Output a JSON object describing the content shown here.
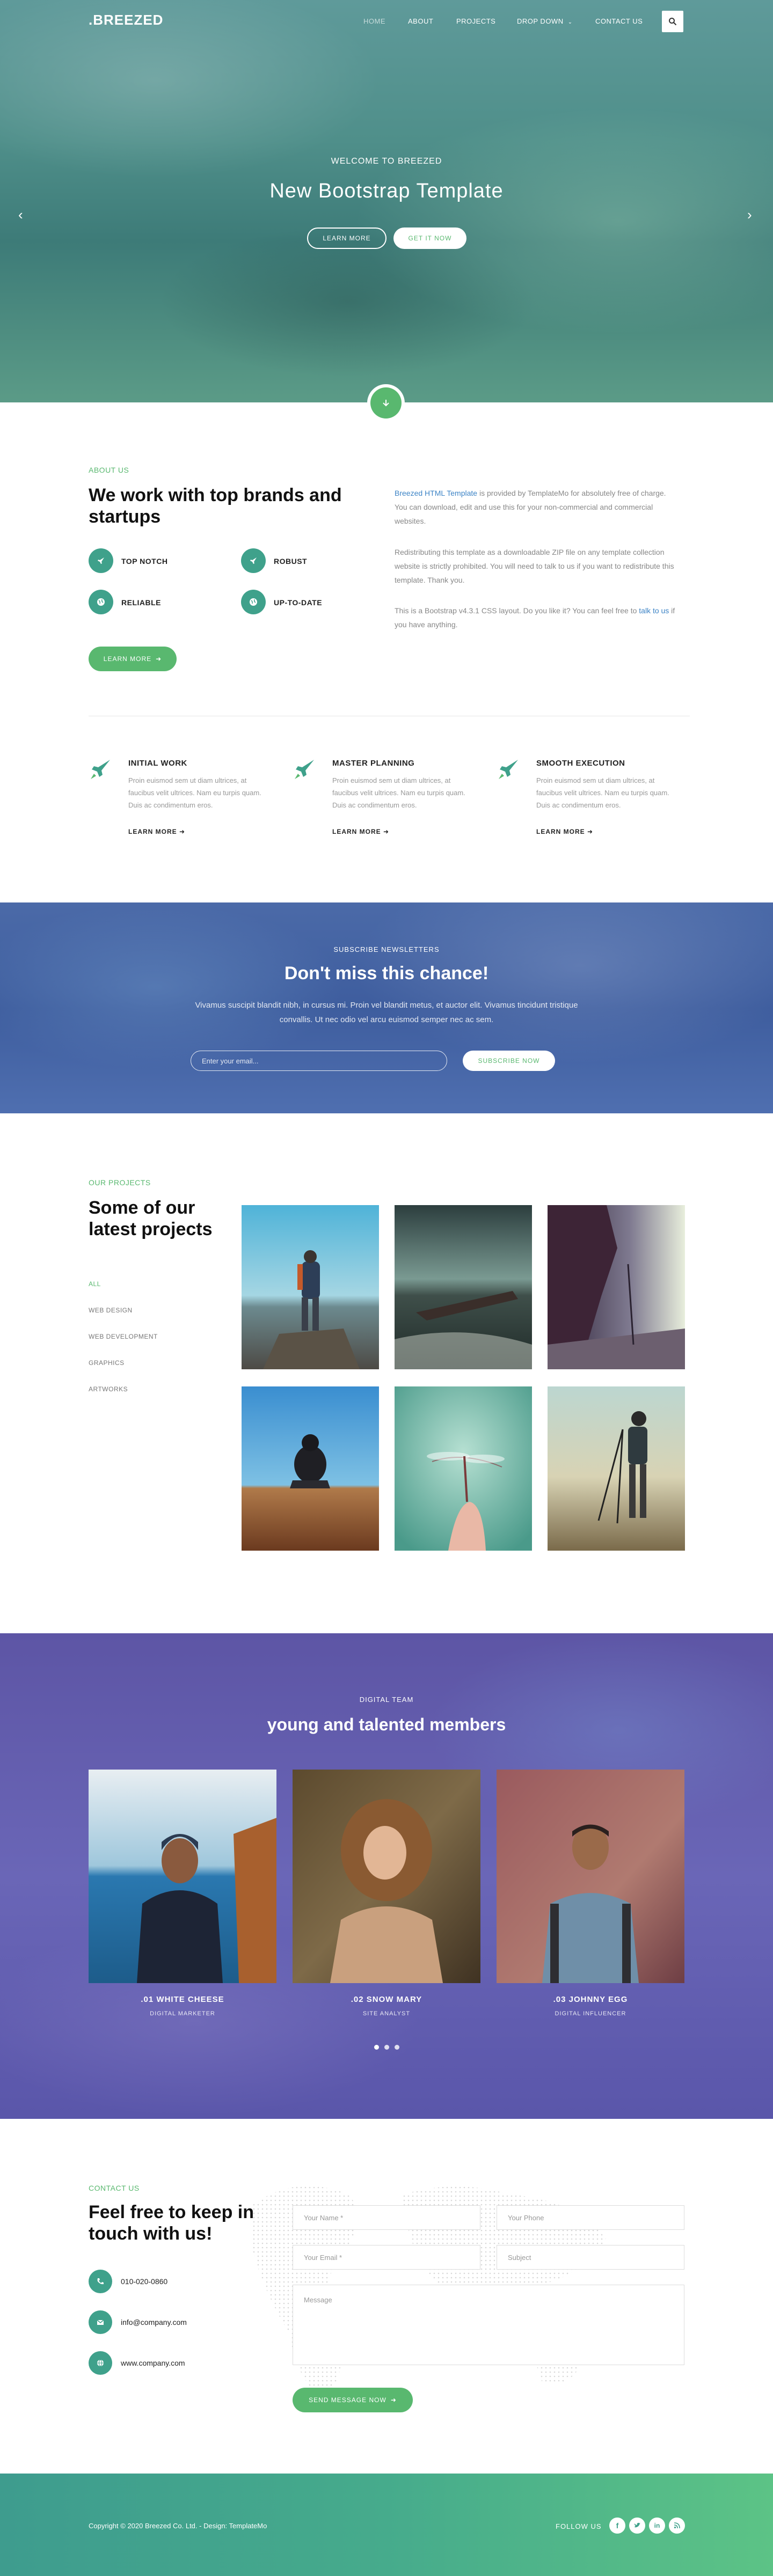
{
  "brand": {
    "logo": ".BREEZED",
    "accent": "#59b86f",
    "teal": "#3fa18b"
  },
  "nav": {
    "home": "HOME",
    "about": "ABOUT",
    "projects": "PROJECTS",
    "dropdown": "DROP DOWN",
    "contact": "CONTACT US"
  },
  "hero": {
    "subtitle": "WELCOME TO BREEZED",
    "title": "New Bootstrap Template",
    "btn_learn": "LEARN MORE",
    "btn_get": "GET IT NOW"
  },
  "about": {
    "label": "ABOUT US",
    "title": "We work with top brands and startups",
    "features": [
      "TOP NOTCH",
      "ROBUST",
      "RELIABLE",
      "UP-TO-DATE"
    ],
    "btn": "LEARN MORE",
    "p1_link": "Breezed HTML Template",
    "p1_rest": " is provided by TemplateMo for absolutely free of charge. You can download, edit and use this for your non-commercial and commercial websites.",
    "p2": "Redistributing this template as a downloadable ZIP file on any template collection website is strictly prohibited. You will need to talk to us if you want to redistribute this template. Thank you.",
    "p3_a": "This is a Bootstrap v4.3.1 CSS layout. Do you like it? You can feel free to ",
    "p3_link": "talk to us",
    "p3_b": " if you have anything."
  },
  "services": [
    {
      "title": "INITIAL WORK",
      "text": "Proin euismod sem ut diam ultrices, at faucibus velit ultrices. Nam eu turpis quam. Duis ac condimentum eros.",
      "link": "LEARN MORE"
    },
    {
      "title": "MASTER PLANNING",
      "text": "Proin euismod sem ut diam ultrices, at faucibus velit ultrices. Nam eu turpis quam. Duis ac condimentum eros.",
      "link": "LEARN MORE"
    },
    {
      "title": "SMOOTH EXECUTION",
      "text": "Proin euismod sem ut diam ultrices, at faucibus velit ultrices. Nam eu turpis quam. Duis ac condimentum eros.",
      "link": "LEARN MORE"
    }
  ],
  "subscribe": {
    "label": "SUBSCRIBE NEWSLETTERS",
    "title": "Don't miss this chance!",
    "text": "Vivamus suscipit blandit nibh, in cursus mi. Proin vel blandit metus, et auctor elit. Vivamus tincidunt tristique convallis. Ut nec odio vel arcu euismod semper nec ac sem.",
    "placeholder": "Enter your email...",
    "btn": "SUBSCRIBE NOW"
  },
  "projects": {
    "label": "OUR PROJECTS",
    "title": "Some of our latest projects",
    "filters": [
      "ALL",
      "WEB DESIGN",
      "WEB DEVELOPMENT",
      "GRAPHICS",
      "ARTWORKS"
    ]
  },
  "team": {
    "label": "DIGITAL TEAM",
    "title": "young and talented members",
    "members": [
      {
        "name": ".01 WHITE CHEESE",
        "role": "DIGITAL MARKETER"
      },
      {
        "name": ".02 SNOW MARY",
        "role": "SITE ANALYST"
      },
      {
        "name": ".03 JOHNNY EGG",
        "role": "DIGITAL INFLUENCER"
      }
    ]
  },
  "contact": {
    "label": "CONTACT US",
    "title": "Feel free to keep in touch with us!",
    "phone": "010-020-0860",
    "email": "info@company.com",
    "web": "www.company.com",
    "ph_name": "Your Name *",
    "ph_phone": "Your Phone",
    "ph_email": "Your Email *",
    "ph_subject": "Subject",
    "ph_message": "Message",
    "btn": "SEND MESSAGE NOW"
  },
  "footer": {
    "copyright": "Copyright © 2020 Breezed Co. Ltd. - Design: TemplateMo",
    "follow": "FOLLOW US"
  }
}
